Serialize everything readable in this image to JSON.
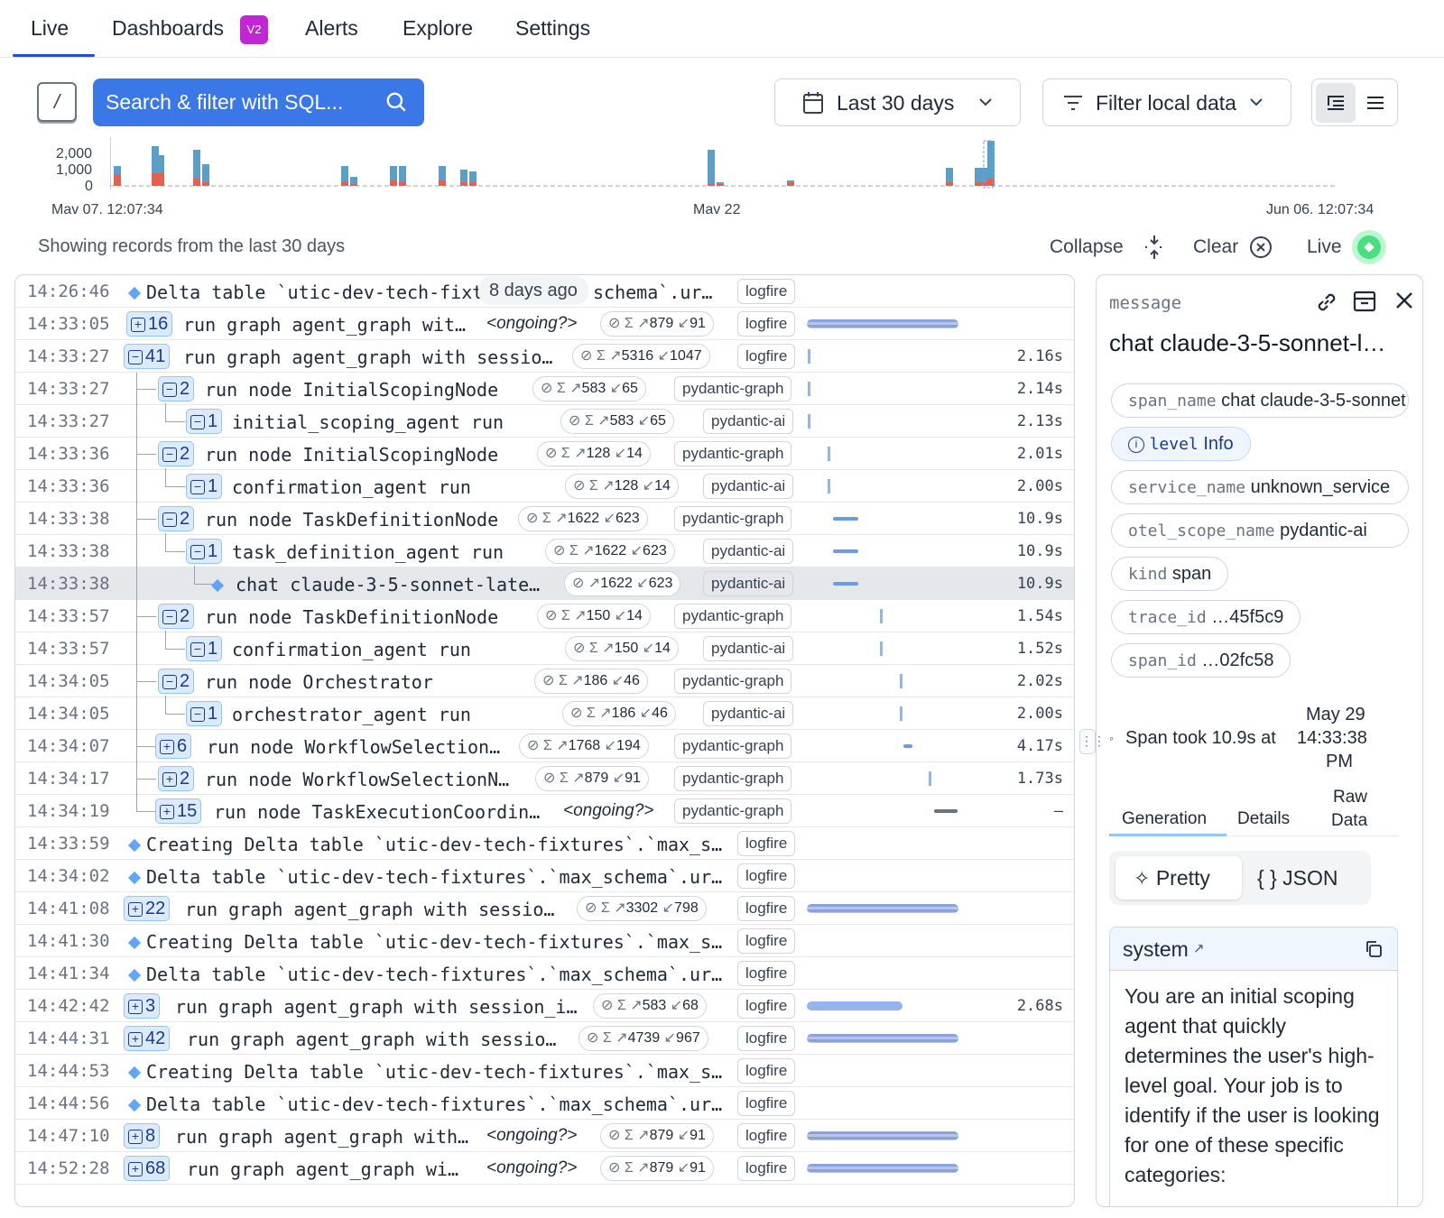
{
  "nav": {
    "tabs": [
      "Live",
      "Dashboards",
      "Alerts",
      "Explore",
      "Settings"
    ],
    "dashboards_badge": "V2"
  },
  "toolbar": {
    "shortcut_key": "/",
    "search_label": "Search & filter with SQL...",
    "date_range": "Last 30 days",
    "filter_label": "Filter local data"
  },
  "histogram": {
    "y_ticks": [
      "2,000",
      "1,000",
      "0"
    ],
    "x_labels": [
      "Mav 07. 12:07:34",
      "Mav 22",
      "Jun 06. 12:07:34"
    ],
    "colors": {
      "info": "#5b9fc7",
      "error": "#e0624f"
    }
  },
  "status": {
    "showing_text": "Showing records from the last 30 days",
    "collapse_label": "Collapse",
    "clear_label": "Clear",
    "live_label": "Live"
  },
  "tooltip": "8 days ago",
  "rows": [
    {
      "time": "14:26:46",
      "msg": "Delta table `utic-dev-tech-fixtu",
      "msg2": "schema`.ur…",
      "tag": "logfire"
    },
    {
      "time": "14:33:05",
      "count": "16",
      "msg": "run graph agent_graph wit…",
      "ongoing": "<ongoing?>",
      "up": "879",
      "down": "91",
      "tag": "logfire"
    },
    {
      "time": "14:33:27",
      "count": "41",
      "msg": "run graph agent_graph with sessio…",
      "up": "5316",
      "down": "1047",
      "tag": "logfire",
      "dur": "2.16s"
    },
    {
      "time": "14:33:27",
      "count": "2",
      "msg": "run node InitialScopingNode",
      "up": "583",
      "down": "65",
      "tag": "pydantic-graph",
      "dur": "2.14s"
    },
    {
      "time": "14:33:27",
      "count": "1",
      "msg": "initial_scoping_agent run",
      "up": "583",
      "down": "65",
      "tag": "pydantic-ai",
      "dur": "2.13s"
    },
    {
      "time": "14:33:36",
      "count": "2",
      "msg": "run node InitialScopingNode",
      "up": "128",
      "down": "14",
      "tag": "pydantic-graph",
      "dur": "2.01s"
    },
    {
      "time": "14:33:36",
      "count": "1",
      "msg": "confirmation_agent run",
      "up": "128",
      "down": "14",
      "tag": "pydantic-ai",
      "dur": "2.00s"
    },
    {
      "time": "14:33:38",
      "count": "2",
      "msg": "run node TaskDefinitionNode",
      "up": "1622",
      "down": "623",
      "tag": "pydantic-graph",
      "dur": "10.9s"
    },
    {
      "time": "14:33:38",
      "count": "1",
      "msg": "task_definition_agent run",
      "up": "1622",
      "down": "623",
      "tag": "pydantic-ai",
      "dur": "10.9s"
    },
    {
      "time": "14:33:38",
      "msg": "chat claude-3-5-sonnet-late…",
      "up": "1622",
      "down": "623",
      "tag": "pydantic-ai",
      "dur": "10.9s"
    },
    {
      "time": "14:33:57",
      "count": "2",
      "msg": "run node TaskDefinitionNode",
      "up": "150",
      "down": "14",
      "tag": "pydantic-graph",
      "dur": "1.54s"
    },
    {
      "time": "14:33:57",
      "count": "1",
      "msg": "confirmation_agent run",
      "up": "150",
      "down": "14",
      "tag": "pydantic-ai",
      "dur": "1.52s"
    },
    {
      "time": "14:34:05",
      "count": "2",
      "msg": "run node Orchestrator",
      "up": "186",
      "down": "46",
      "tag": "pydantic-graph",
      "dur": "2.02s"
    },
    {
      "time": "14:34:05",
      "count": "1",
      "msg": "orchestrator_agent run",
      "up": "186",
      "down": "46",
      "tag": "pydantic-ai",
      "dur": "2.00s"
    },
    {
      "time": "14:34:07",
      "count": "6",
      "msg": "run node WorkflowSelection…",
      "up": "1768",
      "down": "194",
      "tag": "pydantic-graph",
      "dur": "4.17s"
    },
    {
      "time": "14:34:17",
      "count": "2",
      "msg": "run node WorkflowSelectionN…",
      "up": "879",
      "down": "91",
      "tag": "pydantic-graph",
      "dur": "1.73s"
    },
    {
      "time": "14:34:19",
      "count": "15",
      "msg": "run node TaskExecutionCoordin…",
      "ongoing": "<ongoing?>",
      "tag": "pydantic-graph",
      "dur": "—"
    },
    {
      "time": "14:33:59",
      "msg": "Creating Delta table `utic-dev-tech-fixtures`.`max_s…",
      "tag": "logfire"
    },
    {
      "time": "14:34:02",
      "msg": "Delta table `utic-dev-tech-fixtures`.`max_schema`.ur…",
      "tag": "logfire"
    },
    {
      "time": "14:41:08",
      "count": "22",
      "msg": "run graph agent_graph with sessio…",
      "up": "3302",
      "down": "798",
      "tag": "logfire"
    },
    {
      "time": "14:41:30",
      "msg": "Creating Delta table `utic-dev-tech-fixtures`.`max_s…",
      "tag": "logfire"
    },
    {
      "time": "14:41:34",
      "msg": "Delta table `utic-dev-tech-fixtures`.`max_schema`.ur…",
      "tag": "logfire"
    },
    {
      "time": "14:42:42",
      "count": "3",
      "msg": "run graph agent_graph with session_i…",
      "up": "583",
      "down": "68",
      "tag": "logfire",
      "dur": "2.68s"
    },
    {
      "time": "14:44:31",
      "count": "42",
      "msg": "run graph agent_graph with sessio…",
      "up": "4739",
      "down": "967",
      "tag": "logfire"
    },
    {
      "time": "14:44:53",
      "msg": "Creating Delta table `utic-dev-tech-fixtures`.`max_s…",
      "tag": "logfire"
    },
    {
      "time": "14:44:56",
      "msg": "Delta table `utic-dev-tech-fixtures`.`max_schema`.ur…",
      "tag": "logfire"
    },
    {
      "time": "14:47:10",
      "count": "8",
      "msg": "run graph agent_graph with…",
      "ongoing": "<ongoing?>",
      "up": "879",
      "down": "91",
      "tag": "logfire"
    },
    {
      "time": "14:52:28",
      "count": "68",
      "msg": "run graph agent_graph wi…",
      "ongoing": "<ongoing?>",
      "up": "879",
      "down": "91",
      "tag": "logfire"
    }
  ],
  "detail": {
    "label": "message",
    "title": "chat claude-3-5-sonnet-l…",
    "attrs": [
      {
        "k": "span_name",
        "v": "chat claude-3-5-sonnet"
      },
      {
        "k": "level",
        "v": "Info"
      },
      {
        "k": "service_name",
        "v": "unknown_service"
      },
      {
        "k": "otel_scope_name",
        "v": "pydantic-ai"
      },
      {
        "k": "kind",
        "v": "span"
      },
      {
        "k": "trace_id",
        "v": "…45f5c9"
      },
      {
        "k": "span_id",
        "v": "…02fc58"
      }
    ],
    "span_took": "Span took 10.9s at",
    "span_date": "May 29",
    "span_time": "14:33:38",
    "span_ampm": "PM",
    "tabs": [
      "Generation",
      "Details",
      "Raw",
      "Data"
    ],
    "seg": [
      "Pretty",
      "{ } JSON"
    ],
    "system_label": "system",
    "system_text": "You are an initial scoping agent that quickly determines the user's high-level goal. Your job is to identify if the user is looking for one of these specific categories:"
  }
}
